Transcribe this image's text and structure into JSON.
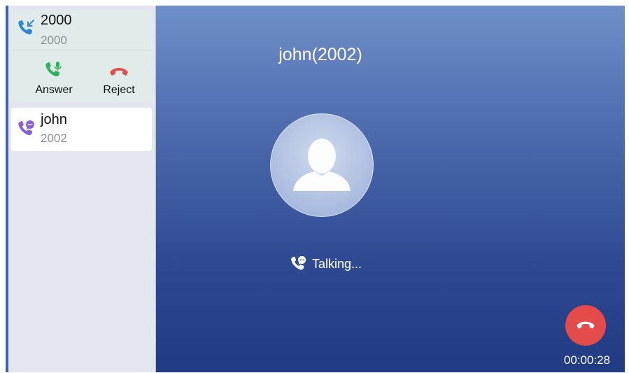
{
  "sidebar": {
    "incoming": {
      "name": "2000",
      "number": "2000",
      "icon": "incoming-call-icon",
      "answer_label": "Answer",
      "answer_icon": "answer-phone-icon",
      "reject_label": "Reject",
      "reject_icon": "reject-phone-icon"
    },
    "active_call": {
      "name": "john",
      "number": "2002",
      "icon": "talking-call-icon"
    }
  },
  "main": {
    "title": "john(2002)",
    "avatar_icon": "contact-avatar-icon",
    "status_icon": "talking-call-icon",
    "status_text": "Talking...",
    "hangup_icon": "hangup-icon",
    "timer": "00:00:28"
  },
  "colors": {
    "answer": "#2fb35a",
    "reject": "#e54b4b",
    "incoming_icon": "#2e86d6",
    "talking_icon": "#8b5fd9"
  }
}
